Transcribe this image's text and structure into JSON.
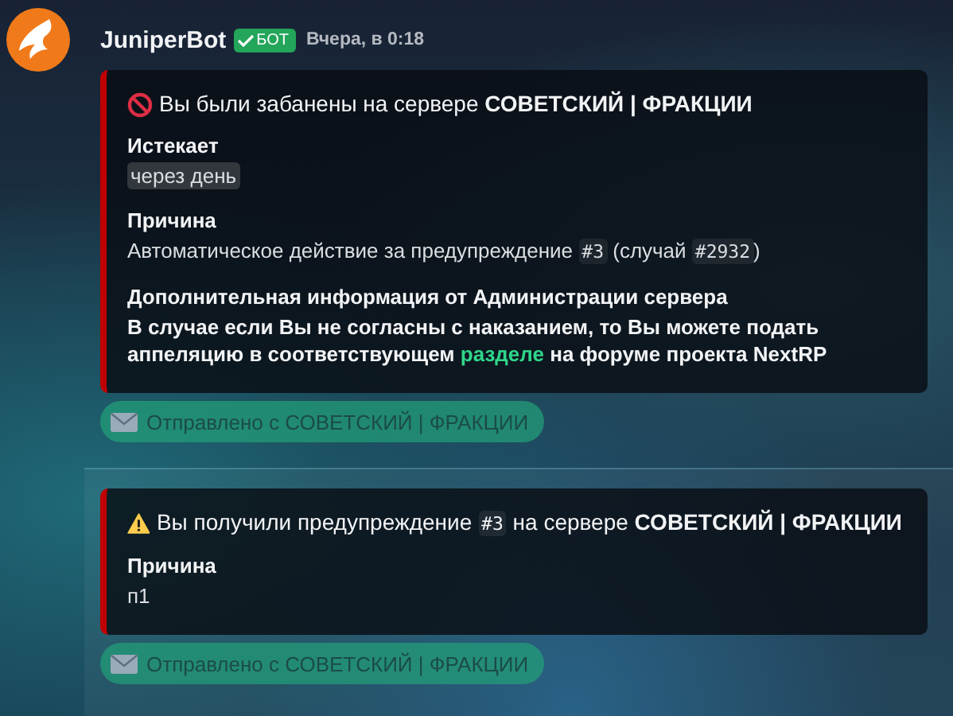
{
  "author": {
    "name": "JuniperBot",
    "badge": "БОТ",
    "verified": true,
    "timestamp": "Вчера, в 0:18"
  },
  "messages": [
    {
      "highlighted": false,
      "embed": {
        "kind": "ban",
        "title": [
          {
            "kind": "text",
            "text": "Вы были забанены на сервере "
          },
          {
            "kind": "bold",
            "text": "СОВЕТСКИЙ | ФРАКЦИИ"
          }
        ],
        "fields": [
          {
            "name": "Истекает",
            "value": [
              {
                "kind": "mark",
                "text": "через день"
              }
            ],
            "bold": false
          },
          {
            "name": "Причина",
            "value": [
              {
                "kind": "text",
                "text": "Автоматическое действие за предупреждение "
              },
              {
                "kind": "code",
                "text": "#3"
              },
              {
                "kind": "text",
                "text": " (случай "
              },
              {
                "kind": "code",
                "text": "#2932"
              },
              {
                "kind": "text",
                "text": ")"
              }
            ],
            "bold": false
          },
          {
            "name": "Дополнительная информация от Администрации сервера",
            "value": [
              {
                "kind": "text",
                "text": "В случае если Вы не согласны с наказанием, то Вы можете подать аппеляцию в соответствующем "
              },
              {
                "kind": "link",
                "text": "разделе"
              },
              {
                "kind": "text",
                "text": " на форуме проекта NextRP"
              }
            ],
            "bold": true
          }
        ]
      },
      "button": "Отправлено с СОВЕТСКИЙ | ФРАКЦИИ"
    },
    {
      "highlighted": true,
      "embed": {
        "kind": "warning",
        "title": [
          {
            "kind": "text",
            "text": "Вы получили предупреждение "
          },
          {
            "kind": "code",
            "text": "#3"
          },
          {
            "kind": "text",
            "text": " на сервере "
          },
          {
            "kind": "bold",
            "text": "СОВЕТСКИЙ | ФРАКЦИИ"
          }
        ],
        "fields": [
          {
            "name": "Причина",
            "value": [
              {
                "kind": "text",
                "text": "п1"
              }
            ],
            "bold": false
          }
        ]
      },
      "button": "Отправлено с СОВЕТСКИЙ | ФРАКЦИИ"
    }
  ]
}
